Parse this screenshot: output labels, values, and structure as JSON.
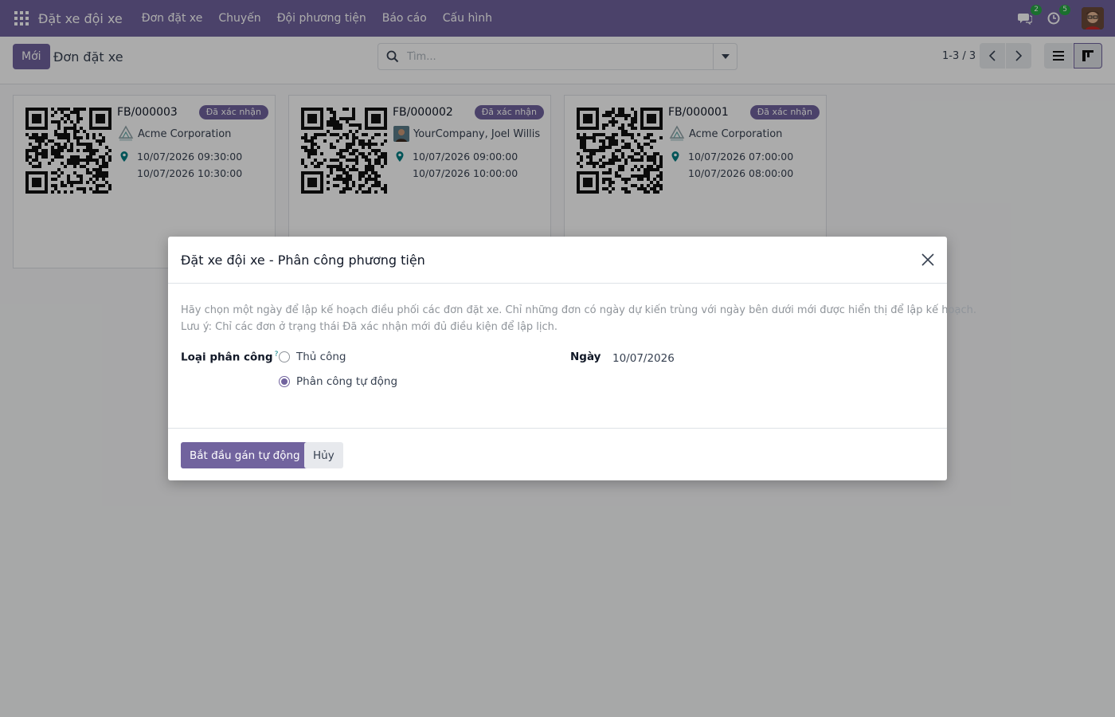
{
  "navbar": {
    "app_name": "Đặt xe đội xe",
    "menu": [
      "Đơn đặt xe",
      "Chuyến",
      "Đội phương tiện",
      "Báo cáo",
      "Cấu hình"
    ],
    "messages_count": "2",
    "activities_count": "5"
  },
  "control_panel": {
    "new_button": "Mới",
    "title": "Đơn đặt xe",
    "search_placeholder": "Tìm...",
    "pager": "1-3 / 3"
  },
  "cards": [
    {
      "ref": "FB/000003",
      "state": "Đã xác nhận",
      "partner": "Acme Corporation",
      "start": "10/07/2026 09:30:00",
      "end": "10/07/2026 10:30:00",
      "logo": "acme-logo"
    },
    {
      "ref": "FB/000002",
      "state": "Đã xác nhận",
      "partner": "YourCompany, Joel Willis",
      "start": "10/07/2026 09:00:00",
      "end": "10/07/2026 10:00:00",
      "logo": "person-avatar"
    },
    {
      "ref": "FB/000001",
      "state": "Đã xác nhận",
      "partner": "Acme Corporation",
      "start": "10/07/2026 07:00:00",
      "end": "10/07/2026 08:00:00",
      "logo": "acme-logo"
    }
  ],
  "dialog": {
    "title": "Đặt xe đội xe - Phân công phương tiện",
    "description_line1": "Hãy chọn một ngày để lập kế hoạch điều phối các đơn đặt xe. Chỉ những đơn có ngày dự kiến trùng với ngày bên dưới mới được hiển thị để lập kế hoạch.",
    "description_line2": "Lưu ý: Chỉ các đơn ở trạng thái Đã xác nhận mới đủ điều kiện để lập lịch.",
    "assignment_label": "Loại phân công",
    "assignment_help": "?",
    "options": [
      "Thủ công",
      "Phân công tự động"
    ],
    "selected_option": "Phân công tự động",
    "date_label": "Ngày",
    "date_value": "10/07/2026",
    "primary_button": "Bắt đầu gán tự động",
    "cancel_button": "Hủy"
  },
  "colors": {
    "brand": "#71639e",
    "badge_green": "#28a745",
    "help": "#017e84"
  }
}
